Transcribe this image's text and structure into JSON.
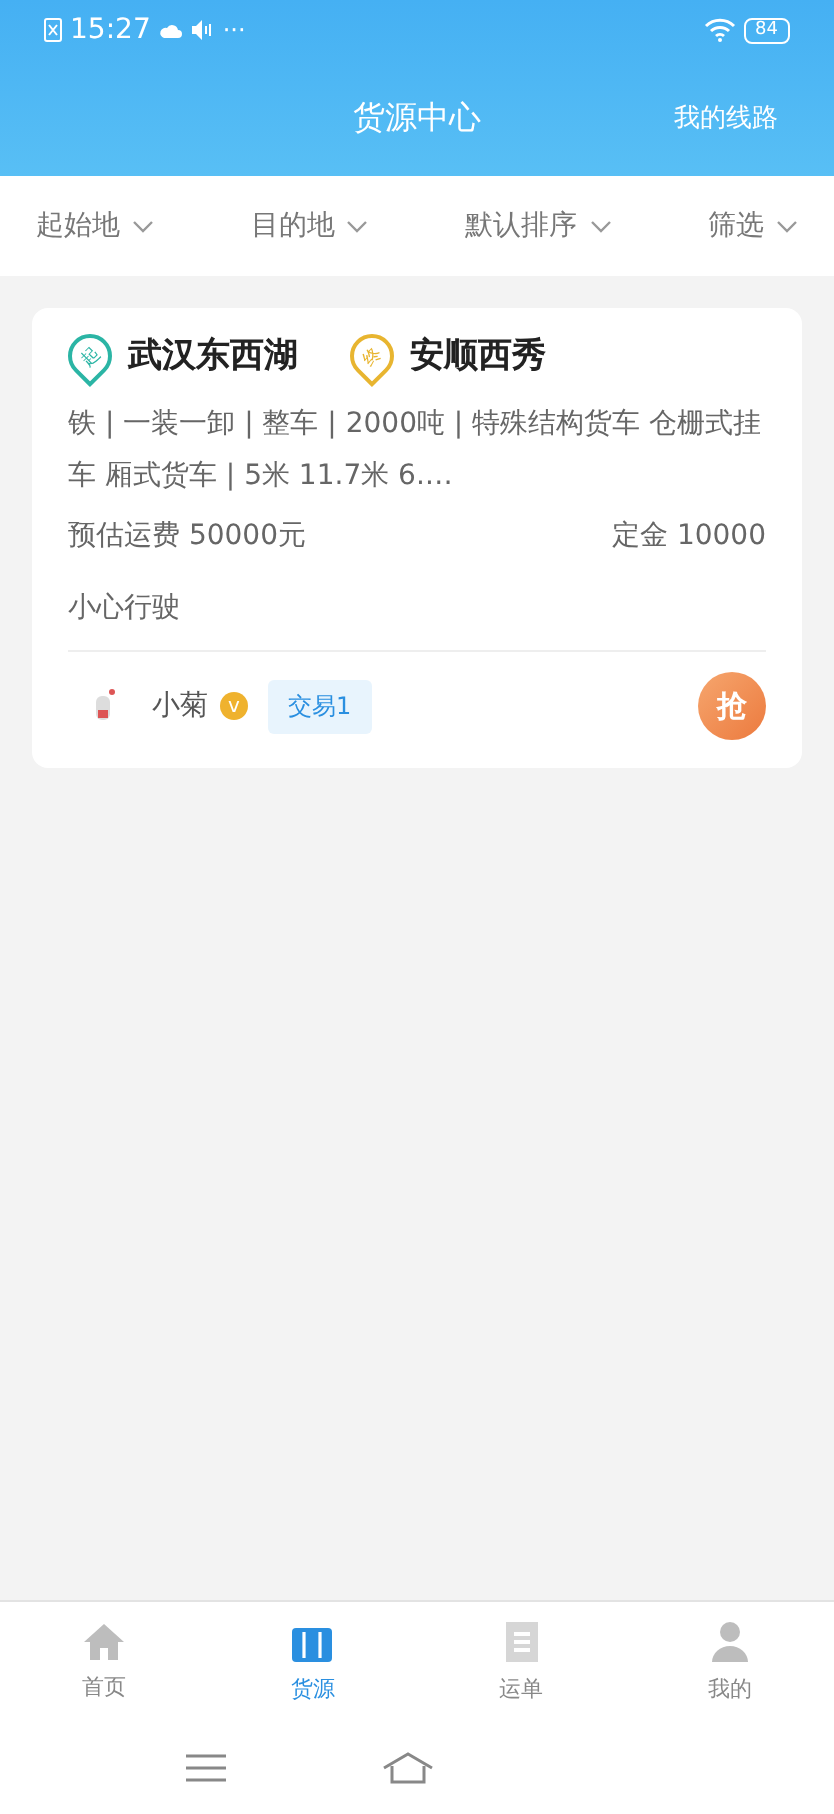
{
  "status_bar": {
    "time": "15:27",
    "more": "···",
    "battery": "84"
  },
  "header": {
    "title": "货源中心",
    "action": "我的线路"
  },
  "filters": [
    {
      "label": "起始地"
    },
    {
      "label": "目的地"
    },
    {
      "label": "默认排序"
    },
    {
      "label": "筛选"
    }
  ],
  "cards": [
    {
      "origin_badge": "起",
      "origin": "武汉东西湖",
      "dest_badge": "终",
      "destination": "安顺西秀",
      "details": "铁 | 一装一卸 | 整车 | 2000吨 | 特殊结构货车 仓栅式挂车 厢式货车 | 5米 11.7米 6.…",
      "freight": "预估运费 50000元",
      "deposit": "定金 10000",
      "note": "小心行驶",
      "user": "小菊",
      "verified_badge": "v",
      "trade_tag": "交易1",
      "grab_button": "抢"
    }
  ],
  "tab_bar": [
    {
      "label": "首页",
      "kind": "home",
      "selected": false
    },
    {
      "label": "货源",
      "kind": "cargo",
      "selected": true
    },
    {
      "label": "运单",
      "kind": "waybill",
      "selected": false
    },
    {
      "label": "我的",
      "kind": "user",
      "selected": false
    }
  ]
}
